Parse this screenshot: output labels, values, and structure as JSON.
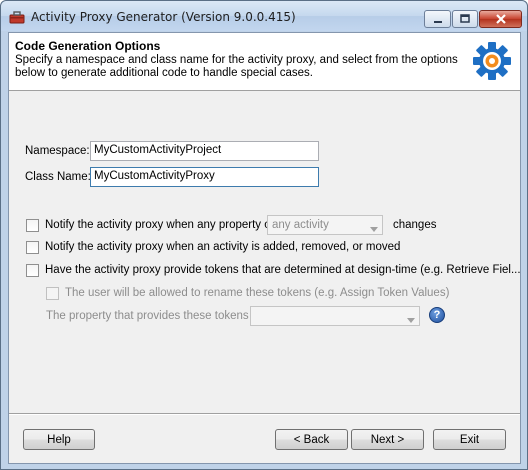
{
  "window": {
    "title": "Activity Proxy Generator (Version 9.0.0.415)",
    "title_icon": "red-toolbox-icon"
  },
  "header": {
    "title": "Code Generation Options",
    "description": "Specify a namespace and class name for the activity proxy, and select from the options below to generate additional code to handle special cases.",
    "icon": "gear-icon"
  },
  "form": {
    "namespace_label": "Namespace:",
    "namespace_value": "MyCustomActivityProject",
    "classname_label": "Class Name:",
    "classname_value": "MyCustomActivityProxy"
  },
  "options": {
    "notify_property_label": "Notify the activity proxy when any property on",
    "notify_property_combo": "any activity",
    "notify_property_suffix": "changes",
    "notify_property_checked": false,
    "notify_activity_label": "Notify the activity proxy when an activity is added, removed, or moved",
    "notify_activity_checked": false,
    "tokens_label": "Have the activity proxy provide tokens that are determined at design-time (e.g. Retrieve Fiel...",
    "tokens_checked": false,
    "rename_tokens_label": "The user will be allowed to rename these tokens (e.g. Assign Token Values)",
    "rename_tokens_checked": false,
    "token_property_label": "The property that provides these tokens is:",
    "token_property_value": "",
    "help_glyph": "?"
  },
  "buttons": {
    "help": "Help",
    "back": "< Back",
    "next": "Next >",
    "exit": "Exit"
  }
}
